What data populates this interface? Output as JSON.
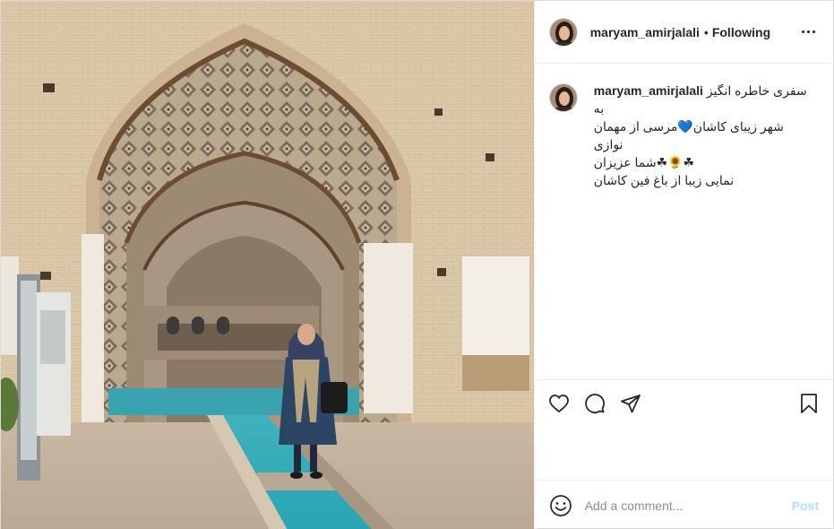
{
  "header": {
    "username": "maryam_amirjalali",
    "dot": "•",
    "follow_status": "Following"
  },
  "caption": {
    "username": "maryam_amirjalali",
    "line1": "سفری خاطره انگیز به",
    "line2": "شهر زیبای کاشان💙مرسی از مهمان نوازی",
    "line3": "☘🌻☘شما عزیزان",
    "line4": "نمایی زیبا از باغ فین کاشان"
  },
  "actions": {
    "like": "heart-icon",
    "comment": "comment-icon",
    "share": "share-icon",
    "save": "bookmark-icon"
  },
  "comment_box": {
    "placeholder": "Add a comment...",
    "post_label": "Post"
  },
  "colors": {
    "accent_disabled": "#b2dffc",
    "text": "#262626",
    "muted": "#8e8e8e",
    "border": "#dbdbdb"
  }
}
